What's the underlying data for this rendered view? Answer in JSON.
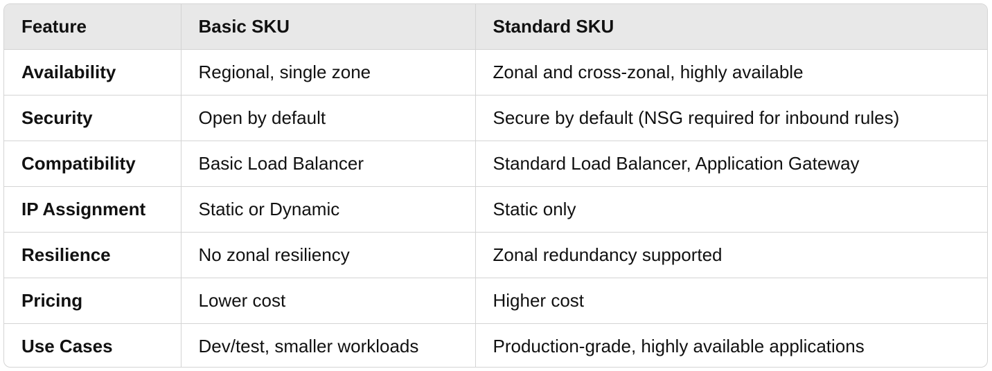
{
  "table": {
    "headers": [
      "Feature",
      "Basic SKU",
      "Standard SKU"
    ],
    "rows": [
      {
        "feature": "Availability",
        "basic": "Regional, single zone",
        "standard": "Zonal and cross-zonal, highly available"
      },
      {
        "feature": "Security",
        "basic": "Open by default",
        "standard": "Secure by default (NSG required for inbound rules)"
      },
      {
        "feature": "Compatibility",
        "basic": "Basic Load Balancer",
        "standard": "Standard Load Balancer, Application Gateway"
      },
      {
        "feature": "IP Assignment",
        "basic": "Static or Dynamic",
        "standard": "Static only"
      },
      {
        "feature": "Resilience",
        "basic": "No zonal resiliency",
        "standard": "Zonal redundancy supported"
      },
      {
        "feature": "Pricing",
        "basic": "Lower cost",
        "standard": "Higher cost"
      },
      {
        "feature": "Use Cases",
        "basic": "Dev/test, smaller workloads",
        "standard": "Production-grade, highly available applications"
      }
    ]
  }
}
